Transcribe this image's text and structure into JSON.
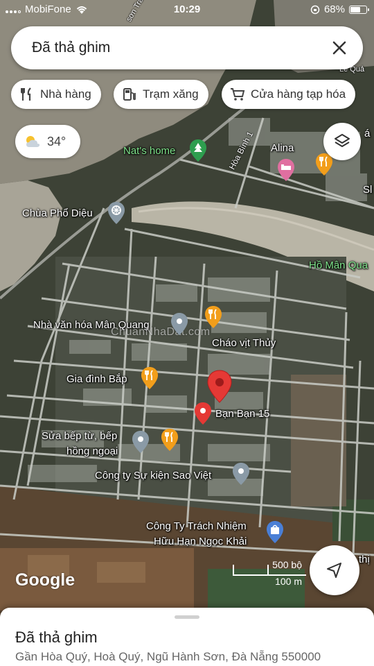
{
  "status_bar": {
    "carrier": "MobiFone",
    "time": "10:29",
    "battery_text": "68%",
    "battery_level": 0.68
  },
  "search": {
    "text": "Đã thả ghim",
    "close_icon": "close-icon"
  },
  "chips": [
    {
      "label": "Nhà hàng",
      "icon": "restaurant-icon"
    },
    {
      "label": "Trạm xăng",
      "icon": "gas-station-icon"
    },
    {
      "label": "Cửa hàng tạp hóa",
      "icon": "cart-icon"
    }
  ],
  "weather": {
    "temperature": "34°",
    "icon": "partly-cloudy-icon"
  },
  "map": {
    "labels": {
      "nats_home": "Nat's home",
      "alina": "Alina",
      "hoa_binh_1": "Hòa Bình 1",
      "le_quang": "Lê Quả",
      "chua_pho_dieu": "Chùa Phổ Diệu",
      "ho_man_quang": "Hồ Mân Qua",
      "nha_van_hoa": "Nhà văn hóa Mân Quang",
      "chao_vit_thuy": "Cháo vịt Thủy",
      "gia_dinh_bap": "Gia đình Bắp",
      "ban_ban_15": "Bạn Bạn 15",
      "sua_bep_line1": "Sửa bếp từ, bếp",
      "sua_bep_line2": "hồng ngoại",
      "cong_ty_su_kien": "Công ty Sự kiện Sao Việt",
      "cong_ty_tnhh_line1": "Công Ty Trách Nhiệm",
      "cong_ty_tnhh_line2": "Hữu Hạn Ngọc Khải",
      "thi": "thị",
      "si": "Sl",
      "son_tra": "sơn Trà",
      "la": "á"
    },
    "watermark": "ChuanNhaDat.com",
    "google_logo": "Google",
    "scale": {
      "imperial": "500 bộ",
      "metric": "100 m"
    }
  },
  "bottom_sheet": {
    "title": "Đã thả ghim",
    "address": "Gần Hòa Quý, Hoà Quý, Ngũ Hành Sơn, Đà Nẵng 550000"
  },
  "colors": {
    "pin_red": "#e53935",
    "poi_orange": "#f29e1b",
    "poi_gray": "#8a9aa6",
    "poi_blue": "#4a7fd6",
    "poi_pink": "#e06fa0",
    "poi_green": "#2e9e4f",
    "label_green": "#7ee28a"
  }
}
